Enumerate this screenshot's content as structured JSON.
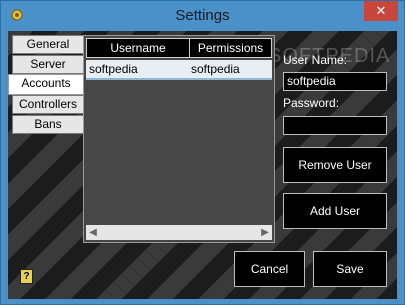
{
  "window": {
    "title": "Settings",
    "close_glyph": "✕",
    "app_icon": "gear-icon"
  },
  "tabs": [
    {
      "label": "General",
      "active": false
    },
    {
      "label": "Server",
      "active": false
    },
    {
      "label": "Accounts",
      "active": true
    },
    {
      "label": "Controllers",
      "active": false
    },
    {
      "label": "Bans",
      "active": false
    }
  ],
  "users_table": {
    "columns": [
      "Username",
      "Permissions"
    ],
    "rows": [
      [
        "softpedia",
        "softpedia"
      ]
    ]
  },
  "form": {
    "username_label": "User Name:",
    "username_value": "softpedia",
    "password_label": "Password:",
    "password_value": ""
  },
  "buttons": {
    "remove_user": "Remove User",
    "add_user": "Add User",
    "cancel": "Cancel",
    "save": "Save",
    "help": "?"
  },
  "watermark": "SOFTPEDIA"
}
